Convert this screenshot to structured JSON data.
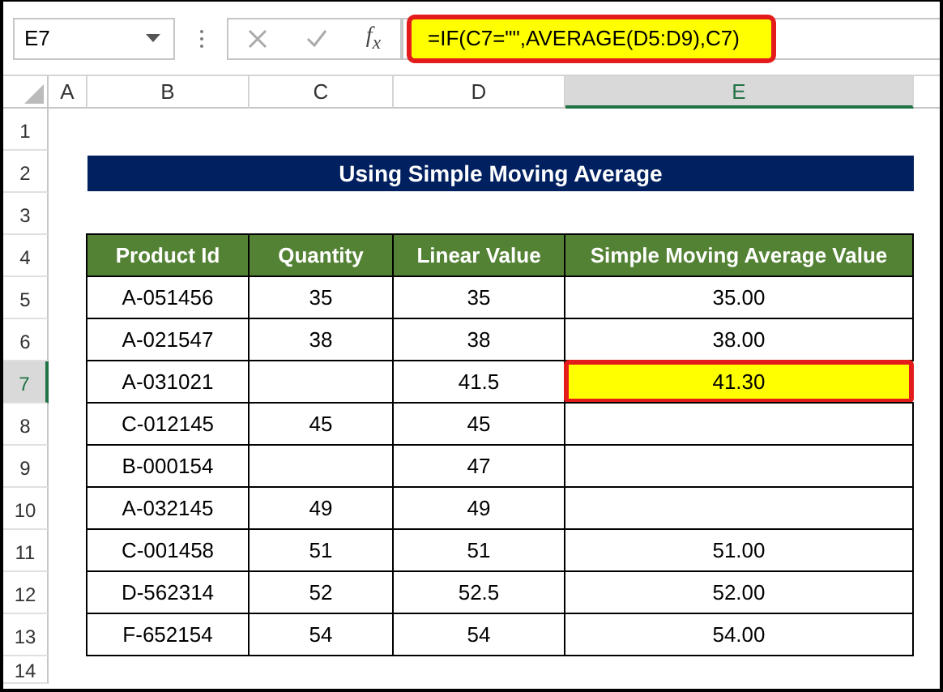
{
  "name_box": {
    "value": "E7"
  },
  "formula_bar": {
    "function_label": "f$_{x}$",
    "formula": "=IF(C7=\"\",AVERAGE(D5:D9),C7)",
    "highlighted": true
  },
  "column_headers": [
    {
      "label": "A",
      "selected": false
    },
    {
      "label": "B",
      "selected": false
    },
    {
      "label": "C",
      "selected": false
    },
    {
      "label": "D",
      "selected": false
    },
    {
      "label": "E",
      "selected": true
    }
  ],
  "row_headers": [
    {
      "label": "1",
      "selected": false
    },
    {
      "label": "2",
      "selected": false
    },
    {
      "label": "3",
      "selected": false
    },
    {
      "label": "4",
      "selected": false
    },
    {
      "label": "5",
      "selected": false
    },
    {
      "label": "6",
      "selected": false
    },
    {
      "label": "7",
      "selected": true
    },
    {
      "label": "8",
      "selected": false
    },
    {
      "label": "9",
      "selected": false
    },
    {
      "label": "10",
      "selected": false
    },
    {
      "label": "11",
      "selected": false
    },
    {
      "label": "12",
      "selected": false
    },
    {
      "label": "13",
      "selected": false
    },
    {
      "label": "14",
      "selected": false
    }
  ],
  "title": "Using Simple Moving Average",
  "table": {
    "columns": [
      "Product Id",
      "Quantity",
      "Linear Value",
      "Simple Moving Average Value"
    ],
    "rows": [
      {
        "product_id": "A-051456",
        "quantity": "35",
        "linear_value": "35",
        "sma_value": "35.00",
        "highlighted": false
      },
      {
        "product_id": "A-021547",
        "quantity": "38",
        "linear_value": "38",
        "sma_value": "38.00",
        "highlighted": false
      },
      {
        "product_id": "A-031021",
        "linear_value": "41.5",
        "sma_value": "41.30",
        "highlighted": true
      },
      {
        "product_id": "C-012145",
        "quantity": "45",
        "linear_value": "45",
        "highlighted": false
      },
      {
        "product_id": "B-000154",
        "linear_value": "47",
        "highlighted": false
      },
      {
        "product_id": "A-032145",
        "quantity": "49",
        "linear_value": "49",
        "highlighted": false
      },
      {
        "product_id": "C-001458",
        "quantity": "51",
        "linear_value": "51",
        "sma_value": "51.00",
        "highlighted": false
      },
      {
        "product_id": "D-562314",
        "quantity": "52",
        "linear_value": "52.5",
        "sma_value": "52.00",
        "highlighted": false
      },
      {
        "product_id": "F-652154",
        "quantity": "54",
        "linear_value": "54",
        "sma_value": "54.00",
        "highlighted": false
      }
    ]
  }
}
